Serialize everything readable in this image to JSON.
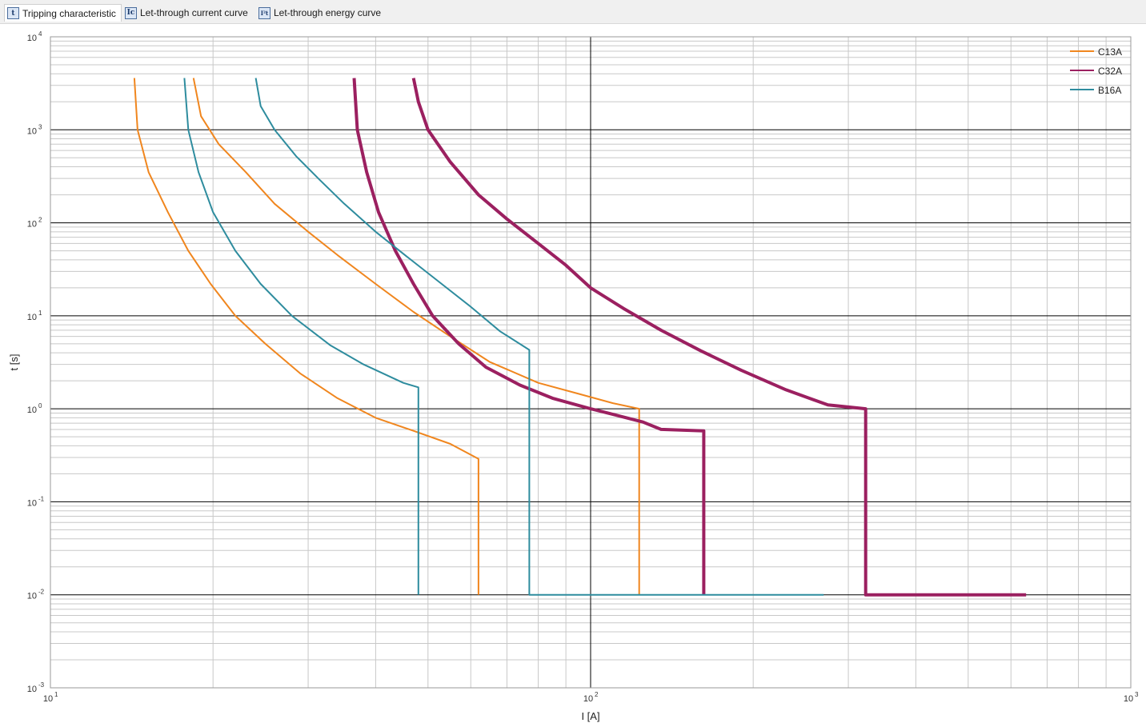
{
  "tabs": [
    {
      "label": "Tripping characteristic",
      "icon": "t",
      "icon_name": "tripping-characteristic-icon",
      "active": true
    },
    {
      "label": "Let-through current curve",
      "icon": "Ic",
      "icon_name": "let-through-current-icon",
      "active": false
    },
    {
      "label": "Let-through energy curve",
      "icon": "I²t",
      "icon_name": "let-through-energy-icon",
      "active": false
    }
  ],
  "chart_data": {
    "type": "line",
    "xlabel": "I [A]",
    "ylabel": "t [s]",
    "x_scale": "log",
    "y_scale": "log",
    "xlim": [
      10,
      1000
    ],
    "ylim": [
      0.001,
      10000
    ],
    "x_ticks": [
      {
        "base": "10",
        "exp": "1"
      },
      {
        "base": "10",
        "exp": "2"
      },
      {
        "base": "10",
        "exp": "3"
      }
    ],
    "y_ticks": [
      {
        "base": "10",
        "exp": "4"
      },
      {
        "base": "10",
        "exp": "3"
      },
      {
        "base": "10",
        "exp": "2"
      },
      {
        "base": "10",
        "exp": "1"
      },
      {
        "base": "10",
        "exp": "0"
      },
      {
        "base": "10",
        "exp": "-1"
      },
      {
        "base": "10",
        "exp": "-2"
      },
      {
        "base": "10",
        "exp": "-3"
      }
    ],
    "grid": true,
    "legend_position": "top-right",
    "series": [
      {
        "name": "C13A",
        "color": "#f0861e",
        "width": 2,
        "curves": [
          [
            [
              14.3,
              3600
            ],
            [
              14.5,
              1000
            ],
            [
              15.2,
              350
            ],
            [
              16.5,
              130
            ],
            [
              18,
              50
            ],
            [
              19.8,
              22
            ],
            [
              22,
              10
            ],
            [
              25,
              5
            ],
            [
              29,
              2.4
            ],
            [
              34,
              1.3
            ],
            [
              40,
              0.8
            ],
            [
              47,
              0.58
            ],
            [
              55,
              0.42
            ],
            [
              62,
              0.29
            ],
            [
              62,
              0.01
            ]
          ],
          [
            [
              18.4,
              3600
            ],
            [
              19,
              1400
            ],
            [
              20.5,
              700
            ],
            [
              23,
              350
            ],
            [
              26,
              160
            ],
            [
              30,
              80
            ],
            [
              34,
              45
            ],
            [
              40,
              22
            ],
            [
              47,
              11
            ],
            [
              55,
              6
            ],
            [
              65,
              3.2
            ],
            [
              80,
              1.9
            ],
            [
              95,
              1.45
            ],
            [
              110,
              1.15
            ],
            [
              123,
              1
            ],
            [
              123,
              0.01
            ]
          ]
        ]
      },
      {
        "name": "C32A",
        "color": "#9b2060",
        "width": 4,
        "curves": [
          [
            [
              36.5,
              3600
            ],
            [
              37,
              1000
            ],
            [
              38.5,
              350
            ],
            [
              40.5,
              130
            ],
            [
              43.5,
              50
            ],
            [
              47,
              22
            ],
            [
              51,
              10
            ],
            [
              57,
              5
            ],
            [
              64,
              2.8
            ],
            [
              74,
              1.8
            ],
            [
              85,
              1.3
            ],
            [
              100,
              1
            ],
            [
              112,
              0.85
            ],
            [
              125,
              0.72
            ],
            [
              135,
              0.6
            ],
            [
              162,
              0.58
            ],
            [
              162,
              0.01
            ]
          ],
          [
            [
              47,
              3600
            ],
            [
              48,
              2000
            ],
            [
              50,
              1000
            ],
            [
              55,
              450
            ],
            [
              62,
              200
            ],
            [
              70,
              110
            ],
            [
              80,
              60
            ],
            [
              90,
              35
            ],
            [
              100,
              20
            ],
            [
              115,
              12
            ],
            [
              135,
              7
            ],
            [
              160,
              4.2
            ],
            [
              190,
              2.6
            ],
            [
              230,
              1.6
            ],
            [
              275,
              1.1
            ],
            [
              323,
              1
            ],
            [
              323,
              0.01
            ],
            [
              640,
              0.01
            ]
          ]
        ]
      },
      {
        "name": "B16A",
        "color": "#2e8c9e",
        "width": 2,
        "curves": [
          [
            [
              17.7,
              3600
            ],
            [
              18,
              1000
            ],
            [
              18.8,
              350
            ],
            [
              20,
              130
            ],
            [
              22,
              50
            ],
            [
              24.5,
              22
            ],
            [
              28,
              10
            ],
            [
              33,
              4.8
            ],
            [
              38,
              3
            ],
            [
              45,
              1.9
            ],
            [
              48,
              1.7
            ],
            [
              48,
              0.01
            ]
          ],
          [
            [
              24,
              3600
            ],
            [
              24.5,
              1800
            ],
            [
              26,
              1000
            ],
            [
              28.5,
              520
            ],
            [
              31.5,
              290
            ],
            [
              35,
              160
            ],
            [
              40,
              80
            ],
            [
              46,
              42
            ],
            [
              53,
              22
            ],
            [
              60,
              12.5
            ],
            [
              68,
              6.8
            ],
            [
              77,
              4.3
            ],
            [
              77,
              0.01
            ],
            [
              270,
              0.01
            ]
          ]
        ]
      }
    ]
  }
}
